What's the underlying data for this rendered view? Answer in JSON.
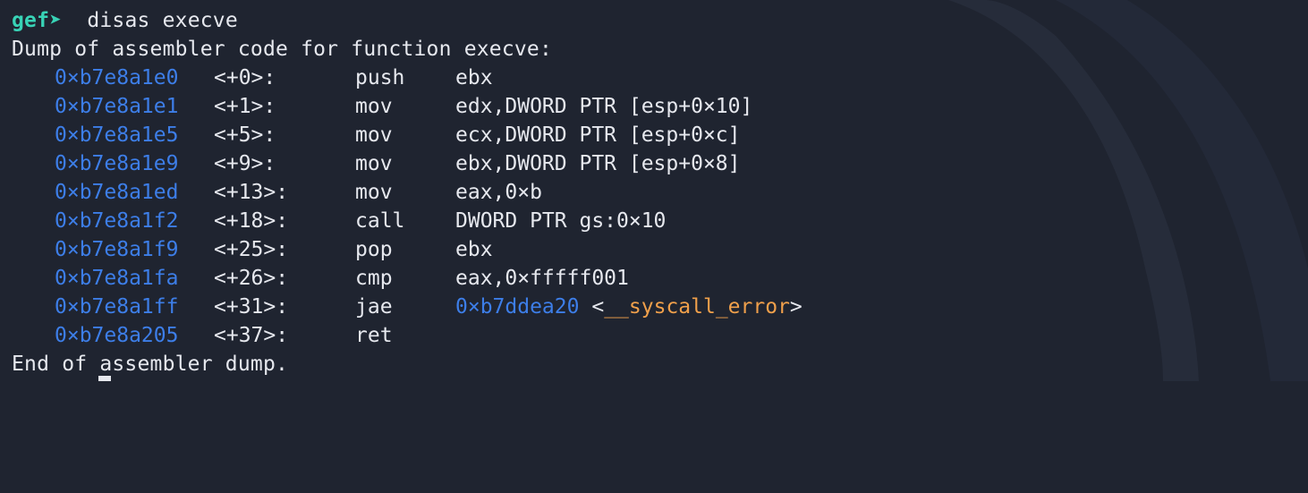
{
  "prompt": {
    "label": "gef➤",
    "command": "disas execve"
  },
  "header": "Dump of assembler code for function execve:",
  "rows": [
    {
      "addr": "0×b7e8a1e0",
      "offset": "<+0>:",
      "mnemonic": "push",
      "operands": "ebx"
    },
    {
      "addr": "0×b7e8a1e1",
      "offset": "<+1>:",
      "mnemonic": "mov",
      "operands": "edx,DWORD PTR [esp+0×10]"
    },
    {
      "addr": "0×b7e8a1e5",
      "offset": "<+5>:",
      "mnemonic": "mov",
      "operands": "ecx,DWORD PTR [esp+0×c]"
    },
    {
      "addr": "0×b7e8a1e9",
      "offset": "<+9>:",
      "mnemonic": "mov",
      "operands": "ebx,DWORD PTR [esp+0×8]"
    },
    {
      "addr": "0×b7e8a1ed",
      "offset": "<+13>:",
      "mnemonic": "mov",
      "operands": "eax,0×b"
    },
    {
      "addr": "0×b7e8a1f2",
      "offset": "<+18>:",
      "mnemonic": "call",
      "operands": "DWORD PTR gs:0×10"
    },
    {
      "addr": "0×b7e8a1f9",
      "offset": "<+25>:",
      "mnemonic": "pop",
      "operands": "ebx"
    },
    {
      "addr": "0×b7e8a1fa",
      "offset": "<+26>:",
      "mnemonic": "cmp",
      "operands": "eax,0×fffff001"
    },
    {
      "addr": "0×b7e8a1ff",
      "offset": "<+31>:",
      "mnemonic": "jae",
      "operands": "",
      "target_addr": "0×b7ddea20",
      "target_sym_open": "<",
      "target_sym": "__syscall_error",
      "target_sym_close": ">"
    },
    {
      "addr": "0×b7e8a205",
      "offset": "<+37>:",
      "mnemonic": "ret",
      "operands": ""
    }
  ],
  "footer": "End of assembler dump.",
  "colors": {
    "background": "#1f2430",
    "prompt": "#38d3b6",
    "address": "#3d7ee8",
    "symbol": "#f0a04b",
    "text": "#e6e8ee"
  }
}
